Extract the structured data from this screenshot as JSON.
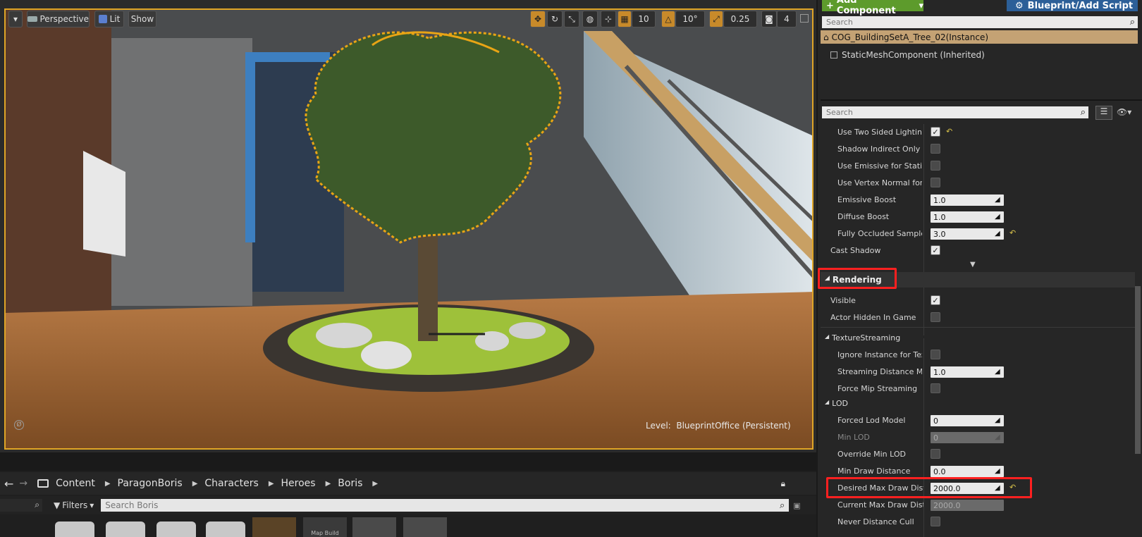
{
  "viewport": {
    "perspective_label": "Perspective",
    "lit_label": "Lit",
    "show_label": "Show",
    "grid_snap_value": "10",
    "rotation_snap_value": "10°",
    "scale_snap_value": "0.25",
    "camera_speed_value": "4",
    "level_label": "Level:",
    "level_name": "BlueprintOffice (Persistent)"
  },
  "content_browser": {
    "breadcrumb": [
      "Content",
      "ParagonBoris",
      "Characters",
      "Heroes",
      "Boris"
    ],
    "filters_label": "Filters",
    "search_placeholder": "Search Boris",
    "thumb_map_build_label": "Map Build"
  },
  "details": {
    "add_component_label": "Add Component",
    "blueprint_label": "Blueprint/Add Script",
    "search_placeholder": "Search",
    "instance_name": "COG_BuildingSetA_Tree_02(Instance)",
    "component_name": "StaticMeshComponent (Inherited)",
    "details_search_placeholder": "Search",
    "properties": [
      {
        "label": "Use Two Sided Lighting",
        "kind": "check",
        "checked": true,
        "reset": true
      },
      {
        "label": "Shadow Indirect Only",
        "kind": "check",
        "checked": false
      },
      {
        "label": "Use Emissive for Static L",
        "kind": "check",
        "checked": false
      },
      {
        "label": "Use Vertex Normal for He",
        "kind": "check",
        "checked": false
      },
      {
        "label": "Emissive Boost",
        "kind": "num",
        "value": "1.0"
      },
      {
        "label": "Diffuse Boost",
        "kind": "num",
        "value": "1.0"
      },
      {
        "label": "Fully Occluded Samples F",
        "kind": "num",
        "value": "3.0",
        "reset": true
      },
      {
        "label": "Cast Shadow",
        "kind": "check",
        "checked": true
      }
    ],
    "rendering_header": "Rendering",
    "rendering": [
      {
        "label": "Visible",
        "kind": "check",
        "checked": true
      },
      {
        "label": "Actor Hidden In Game",
        "kind": "check",
        "checked": false
      }
    ],
    "texture_streaming_header": "TextureStreaming",
    "texture_streaming": [
      {
        "label": "Ignore Instance for Textu",
        "kind": "check",
        "checked": false
      },
      {
        "label": "Streaming Distance Multi",
        "kind": "num",
        "value": "1.0"
      },
      {
        "label": "Force Mip Streaming",
        "kind": "check",
        "checked": false
      }
    ],
    "lod_header": "LOD",
    "lod": [
      {
        "label": "Forced Lod Model",
        "kind": "num",
        "value": "0"
      },
      {
        "label": "Min LOD",
        "kind": "num",
        "value": "0",
        "disabled": true
      },
      {
        "label": "Override Min LOD",
        "kind": "check",
        "checked": false
      },
      {
        "label": "Min Draw Distance",
        "kind": "num",
        "value": "0.0"
      },
      {
        "label": "Desired Max Draw Distan",
        "kind": "num",
        "value": "2000.0",
        "reset": true
      },
      {
        "label": "Current Max Draw Distanc",
        "kind": "num",
        "value": "2000.0",
        "disabled": true
      },
      {
        "label": "Never Distance Cull",
        "kind": "check",
        "checked": false
      }
    ]
  }
}
